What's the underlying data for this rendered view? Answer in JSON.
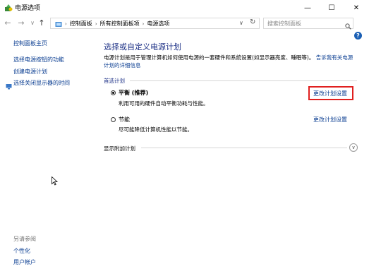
{
  "window": {
    "title": "电源选项",
    "minimize": "—",
    "maximize": "☐",
    "close": "✕"
  },
  "nav": {
    "back": "←",
    "forward": "→",
    "recent": "∨",
    "up": "↑",
    "breadcrumb": [
      "控制面板",
      "所有控制面板项",
      "电源选项"
    ],
    "dropdown": "∨",
    "refresh": "↻",
    "search_placeholder": "搜索控制面板"
  },
  "help": "?",
  "sidebar": {
    "home": "控制面板主页",
    "links": [
      "选择电源按钮的功能",
      "创建电源计划",
      "选择关闭显示器的时间"
    ],
    "see_also_label": "另请参阅",
    "see_also": [
      "个性化",
      "用户帐户"
    ]
  },
  "main": {
    "title": "选择或自定义电源计划",
    "description": "电源计划是用于管理计算机如何使用电源的一套硬件和系统设置(如显示器亮度、睡眠等)。",
    "description_link": "告诉我有关电源计划的详细信息",
    "plans_label": "首选计划",
    "plans": [
      {
        "name": "平衡 (推荐)",
        "description": "利用可用的硬件自动平衡功耗与性能。",
        "selected": true,
        "change_label": "更改计划设置"
      },
      {
        "name": "节能",
        "description": "尽可能降低计算机性能以节能。",
        "selected": false,
        "change_label": "更改计划设置"
      }
    ],
    "extra_plans_label": "显示附加计划",
    "expand_icon": "∨"
  },
  "colors": {
    "link": "#0a3d91",
    "heading": "#1e3287",
    "highlight": "#e0201f"
  }
}
